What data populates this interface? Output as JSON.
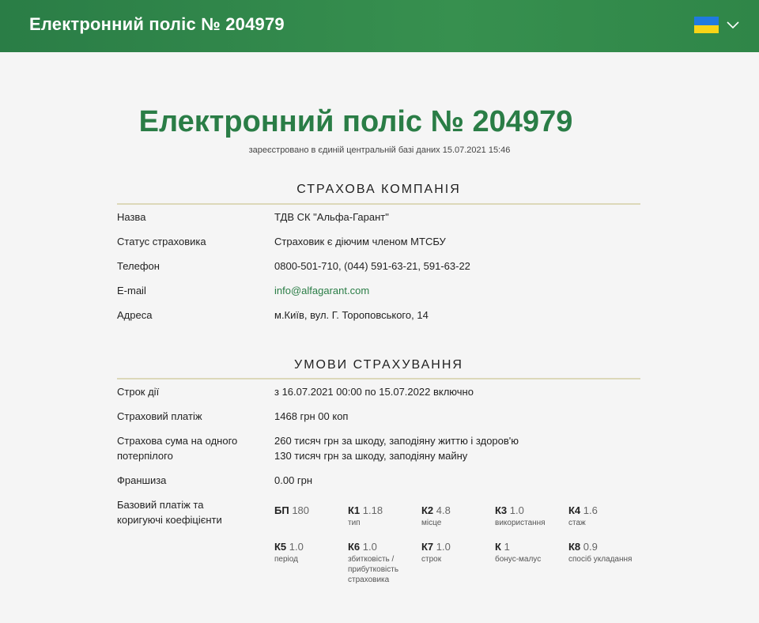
{
  "header": {
    "title": "Електронний поліс № 204979",
    "language_flag_icon": "ukraine-flag-icon",
    "language_dropdown_icon": "chevron-down-icon"
  },
  "page": {
    "title": "Електронний поліс № 204979",
    "registered": "зареєстровано в єдиній центральній базі даних 15.07.2021 15:46"
  },
  "company": {
    "section_title": "СТРАХОВА КОМПАНІЯ",
    "rows": [
      {
        "label": "Назва",
        "value": "ТДВ СК \"Альфа-Гарант\""
      },
      {
        "label": "Статус страховика",
        "value": "Страховик є діючим членом МТСБУ"
      },
      {
        "label": "Телефон",
        "value": "0800-501-710, (044) 591-63-21, 591-63-22"
      },
      {
        "label": "E-mail",
        "value": "info@alfagarant.com"
      },
      {
        "label": "Адреса",
        "value": "м.Київ, вул. Г. Тороповського, 14"
      }
    ]
  },
  "terms": {
    "section_title": "УМОВИ СТРАХУВАННЯ",
    "rows": [
      {
        "label": "Строк дії",
        "value": "з 16.07.2021 00:00 по 15.07.2022 включно"
      },
      {
        "label": "Страховий платіж",
        "value": "1468 грн 00 коп"
      },
      {
        "label_line1": "Страхова сума на одного",
        "label_line2": "потерпілого",
        "value_line1": "260 тисяч грн за шкоду, заподіяну життю і здоров'ю",
        "value_line2": "130 тисяч грн за шкоду, заподіяну майну"
      },
      {
        "label": "Франшиза",
        "value": "0.00 грн"
      },
      {
        "label_line1": "Базовий платіж та",
        "label_line2": "коригуючі коефіцієнти"
      }
    ],
    "coefficients": [
      {
        "key": "БП",
        "value": "180",
        "desc": ""
      },
      {
        "key": "К1",
        "value": "1.18",
        "desc": "тип"
      },
      {
        "key": "К2",
        "value": "4.8",
        "desc": "місце"
      },
      {
        "key": "К3",
        "value": "1.0",
        "desc": "використання"
      },
      {
        "key": "К4",
        "value": "1.6",
        "desc": "стаж"
      },
      {
        "key": "К5",
        "value": "1.0",
        "desc": "період"
      },
      {
        "key": "К6",
        "value": "1.0",
        "desc": "збитковість / прибутковість страховика"
      },
      {
        "key": "К7",
        "value": "1.0",
        "desc": "строк"
      },
      {
        "key": "К",
        "value": "1",
        "desc": "бонус-малус"
      },
      {
        "key": "К8",
        "value": "0.9",
        "desc": "спосіб укладання"
      }
    ]
  },
  "colors": {
    "brand_green": "#2a7d46",
    "divider": "#dcd8b9",
    "background": "#f5f5f5"
  }
}
